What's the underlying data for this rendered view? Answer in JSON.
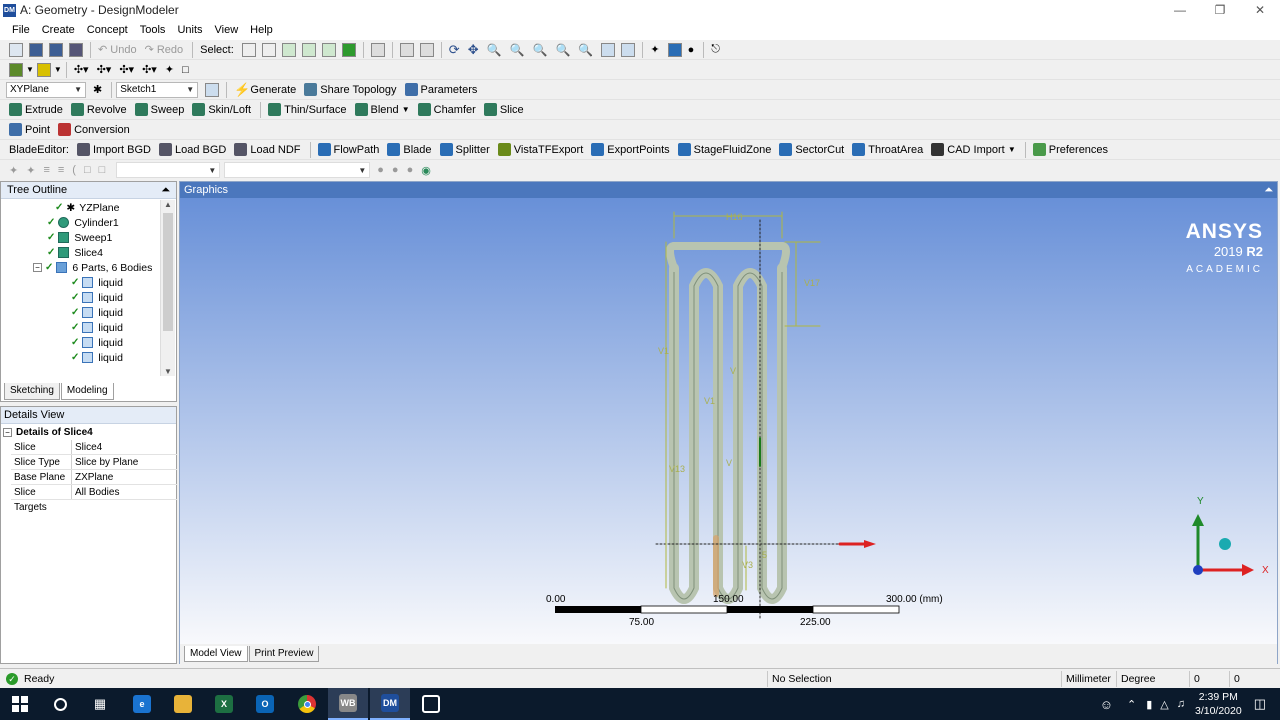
{
  "window": {
    "title": "A: Geometry - DesignModeler",
    "app_icon": "DM"
  },
  "menu": [
    "File",
    "Create",
    "Concept",
    "Tools",
    "Units",
    "View",
    "Help"
  ],
  "toolbar1": {
    "undo": "Undo",
    "redo": "Redo",
    "select_label": "Select:"
  },
  "toolbar3": {
    "plane": "XYPlane",
    "sketch": "Sketch1",
    "generate": "Generate",
    "share_topology": "Share Topology",
    "parameters": "Parameters"
  },
  "toolbar4": {
    "extrude": "Extrude",
    "revolve": "Revolve",
    "sweep": "Sweep",
    "skin_loft": "Skin/Loft",
    "thin_surface": "Thin/Surface",
    "blend": "Blend",
    "chamfer": "Chamfer",
    "slice": "Slice"
  },
  "toolbar5": {
    "point": "Point",
    "conversion": "Conversion"
  },
  "toolbar6": {
    "blade_editor": "BladeEditor:",
    "import_bgd": "Import BGD",
    "load_bgd": "Load BGD",
    "load_ndf": "Load NDF",
    "flowpath": "FlowPath",
    "blade": "Blade",
    "splitter": "Splitter",
    "vistatf": "VistaTFExport",
    "export_points": "ExportPoints",
    "stage_fluid_zone": "StageFluidZone",
    "sector_cut": "SectorCut",
    "throat_area": "ThroatArea",
    "cad_import": "CAD Import",
    "preferences": "Preferences"
  },
  "tree": {
    "header": "Tree Outline",
    "items": [
      {
        "label": "YZPlane"
      },
      {
        "label": "Cylinder1"
      },
      {
        "label": "Sweep1"
      },
      {
        "label": "Slice4"
      },
      {
        "label": "6 Parts, 6 Bodies"
      },
      {
        "label": "liquid"
      },
      {
        "label": "liquid"
      },
      {
        "label": "liquid"
      },
      {
        "label": "liquid"
      },
      {
        "label": "liquid"
      },
      {
        "label": "liquid"
      }
    ],
    "tabs": [
      "Sketching",
      "Modeling"
    ]
  },
  "details": {
    "header": "Details View",
    "group": "Details of Slice4",
    "rows": [
      {
        "key": "Slice",
        "value": "Slice4"
      },
      {
        "key": "Slice Type",
        "value": "Slice by Plane"
      },
      {
        "key": "Base Plane",
        "value": "ZXPlane"
      },
      {
        "key": "Slice Targets",
        "value": "All Bodies"
      }
    ]
  },
  "graphics": {
    "header": "Graphics",
    "logo": {
      "brand": "ANSYS",
      "version": "2019",
      "release": "R2",
      "edition": "ACADEMIC"
    },
    "dims": [
      "H16",
      "V17",
      "V1",
      "V1",
      "V",
      "V",
      "V13",
      "V3",
      "5"
    ],
    "scale": {
      "ticks_top": [
        "0.00",
        "150.00",
        "300.00 (mm)"
      ],
      "ticks_bottom": [
        "75.00",
        "225.00"
      ]
    },
    "triad": {
      "y": "Y",
      "x": "X"
    },
    "tabs": [
      "Model View",
      "Print Preview"
    ]
  },
  "status": {
    "ready": "Ready",
    "selection": "No Selection",
    "units": "Millimeter",
    "angle": "Degree",
    "val1": "0",
    "val2": "0"
  },
  "taskbar": {
    "time": "2:39 PM",
    "date": "3/10/2020"
  }
}
